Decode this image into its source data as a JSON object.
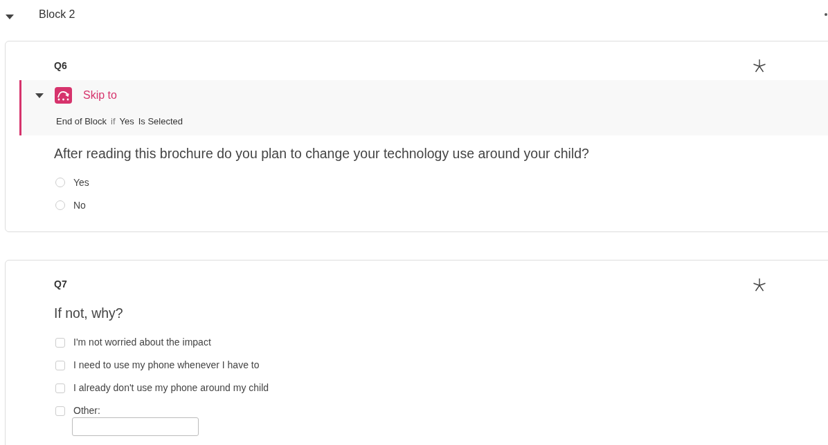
{
  "block": {
    "title": "Block 2",
    "expanded": true
  },
  "questions": [
    {
      "number": "Q6",
      "required": true,
      "kind": "radio",
      "skip_logic": {
        "label": "Skip to",
        "expanded": true,
        "destination": "End of Block",
        "connector": "if",
        "choice": "Yes",
        "condition": "Is Selected"
      },
      "text": "After reading this brochure do you plan to change your technology use around your child?",
      "choices": [
        {
          "label": "Yes",
          "selected": false
        },
        {
          "label": "No",
          "selected": false
        }
      ]
    },
    {
      "number": "Q7",
      "required": true,
      "kind": "checkbox",
      "text": "If not, why?",
      "choices": [
        {
          "label": "I'm not worried about the impact",
          "checked": false
        },
        {
          "label": "I need to use my phone whenever I have to",
          "checked": false
        },
        {
          "label": "I already don't use my phone around my child",
          "checked": false
        },
        {
          "label": "Other:",
          "checked": false,
          "text_entry": true
        }
      ]
    }
  ]
}
